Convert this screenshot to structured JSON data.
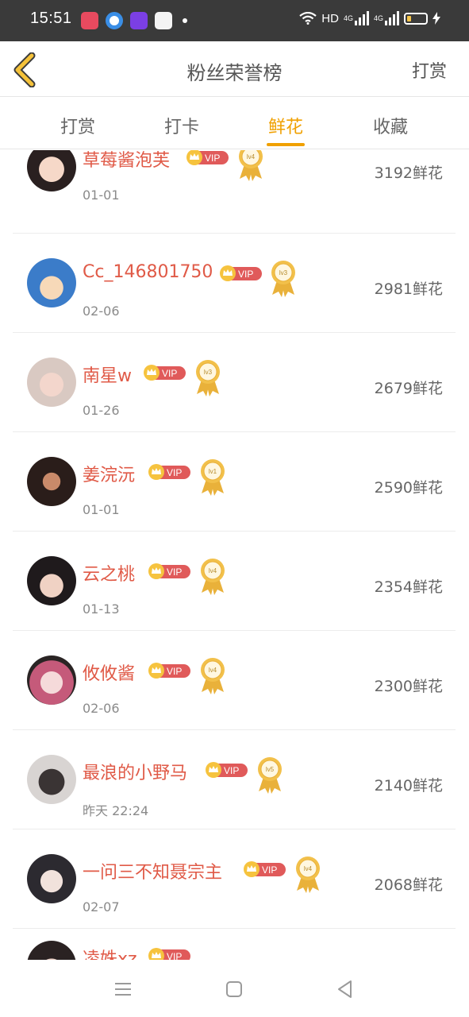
{
  "status_bar": {
    "time": "15:51",
    "network": "HD",
    "signal1": "4G",
    "signal2": "4G"
  },
  "nav": {
    "title": "粉丝荣誉榜",
    "action": "打赏"
  },
  "tabs": [
    {
      "label": "打赏",
      "active": false
    },
    {
      "label": "打卡",
      "active": false
    },
    {
      "label": "鲜花",
      "active": true
    },
    {
      "label": "收藏",
      "active": false
    }
  ],
  "colors": {
    "accent": "#f0a000",
    "name": "#e05a47",
    "vip_badge": "#e05a5a",
    "medal": "#e9b13a"
  },
  "vip_label": "VIP",
  "entries": [
    {
      "name": "草莓酱泡芙",
      "date": "01-01",
      "count": "3192鲜花",
      "level": "lv4"
    },
    {
      "name": "Cc_146801750",
      "date": "02-06",
      "count": "2981鲜花",
      "level": "lv3"
    },
    {
      "name": "南星w",
      "date": "01-26",
      "count": "2679鲜花",
      "level": "lv3"
    },
    {
      "name": "姜浣沅",
      "date": "01-01",
      "count": "2590鲜花",
      "level": "lv1"
    },
    {
      "name": "云之桃",
      "date": "01-13",
      "count": "2354鲜花",
      "level": "lv4"
    },
    {
      "name": "攸攸酱",
      "date": "02-06",
      "count": "2300鲜花",
      "level": "lv4"
    },
    {
      "name": "最浪的小野马",
      "date": "昨天 22:24",
      "count": "2140鲜花",
      "level": "lv5"
    },
    {
      "name": "一问三不知聂宗主",
      "date": "02-07",
      "count": "2068鲜花",
      "level": "lv4"
    },
    {
      "name": "凌姝xz",
      "date": "",
      "count": "",
      "level": ""
    }
  ],
  "icons": {
    "back": "chevron-left-icon",
    "menu": "menu-icon",
    "home": "home-square-icon",
    "back_triangle": "back-triangle-icon"
  }
}
